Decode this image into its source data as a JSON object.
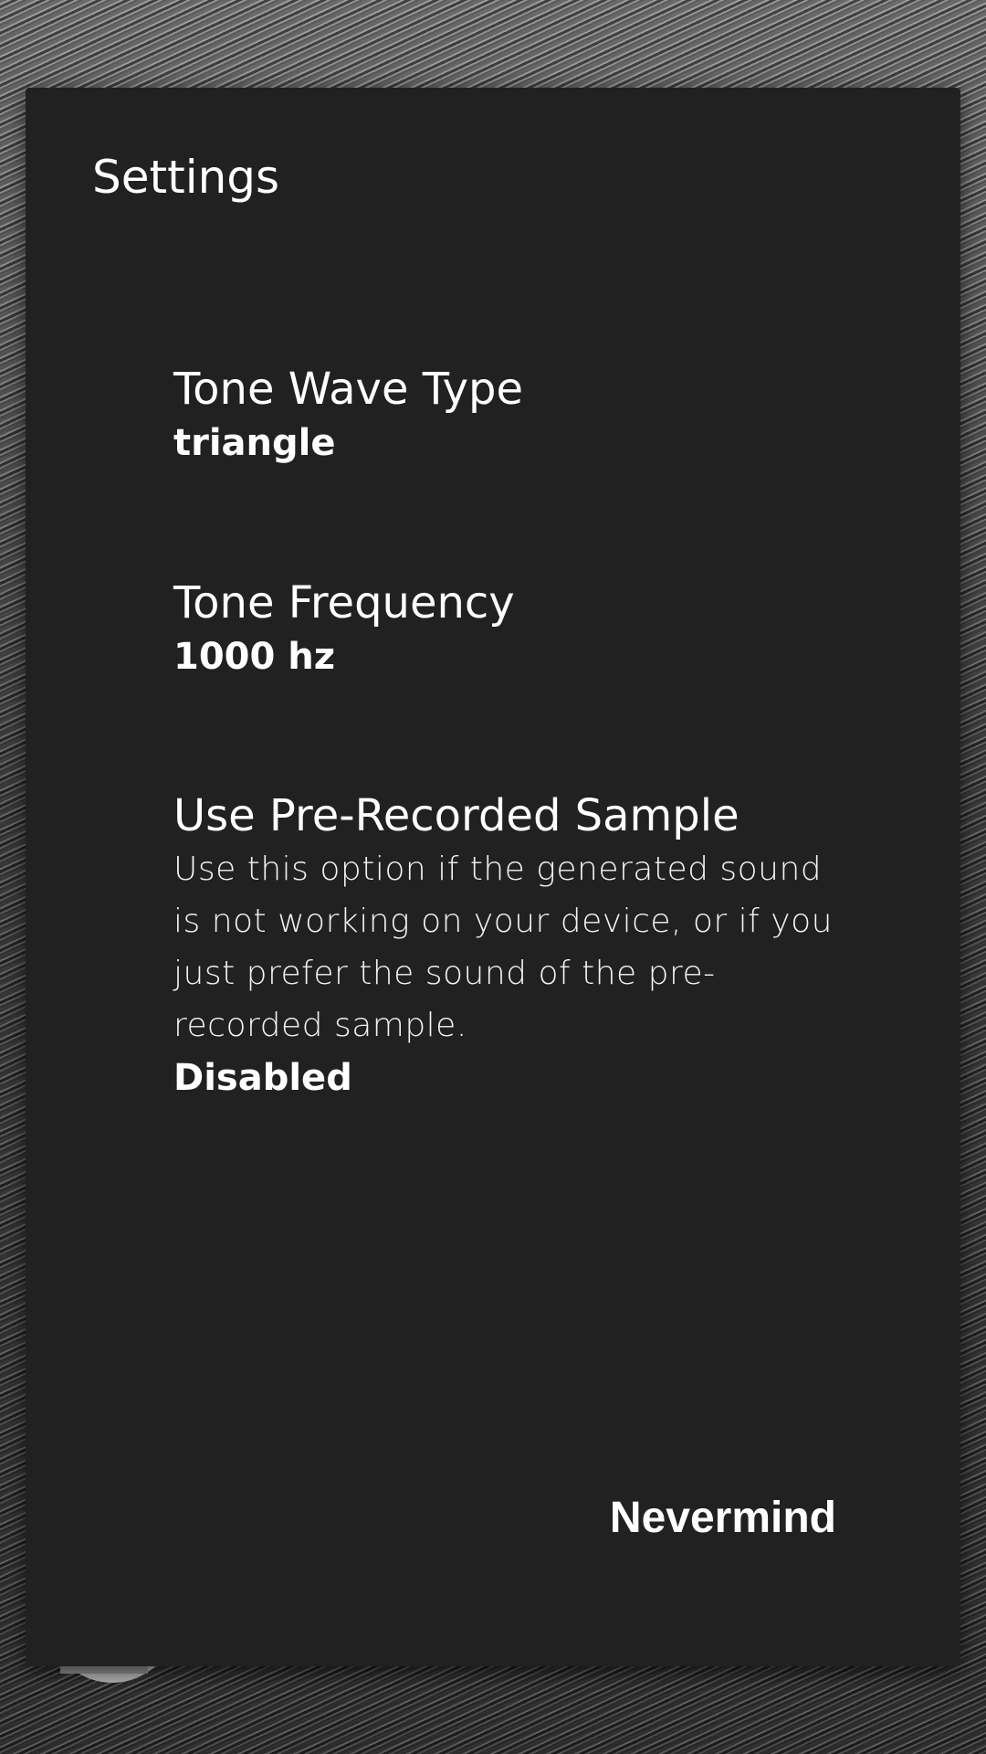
{
  "dialog": {
    "title": "Settings",
    "preferences": [
      {
        "title": "Tone Wave Type",
        "value": "triangle"
      },
      {
        "title": "Tone Frequency",
        "value": "1000 hz"
      },
      {
        "title": "Use Pre-Recorded Sample",
        "summary": "Use this option if the generated sound is not working on your device, or if you just prefer the sound of the pre-recorded sample.",
        "value": "Disabled"
      }
    ],
    "nevermind_label": "Nevermind"
  },
  "colors": {
    "dialog_background": "#212121",
    "text": "#ffffff"
  }
}
